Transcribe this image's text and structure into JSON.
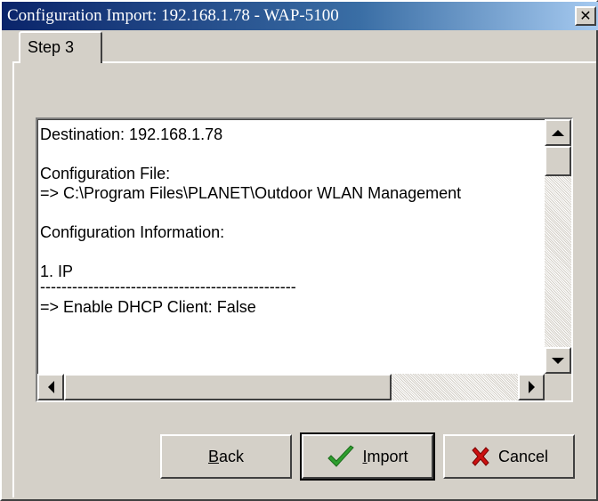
{
  "window": {
    "title": "Configuration Import: 192.168.1.78 - WAP-5100",
    "close_glyph": "✕"
  },
  "tab": {
    "label": "Step 3"
  },
  "content": {
    "lines": {
      "destination": "Destination: 192.168.1.78",
      "config_file_label": "Configuration File:",
      "config_file_path": "=> C:\\Program Files\\PLANET\\Outdoor WLAN Management",
      "config_info_label": "Configuration Information:",
      "section_ip": "1. IP",
      "separator": "------------------------------------------------",
      "dhcp_client": "=> Enable DHCP Client: False"
    }
  },
  "buttons": {
    "back": {
      "label_prefix": "",
      "mnemonic": "B",
      "label_rest": "ack"
    },
    "import": {
      "mnemonic": "I",
      "label_rest": "mport",
      "icon": "checkmark-icon",
      "icon_color": "#2e9e2e"
    },
    "cancel": {
      "label": "Cancel",
      "icon": "x-mark-icon",
      "icon_color": "#cc1111"
    }
  }
}
